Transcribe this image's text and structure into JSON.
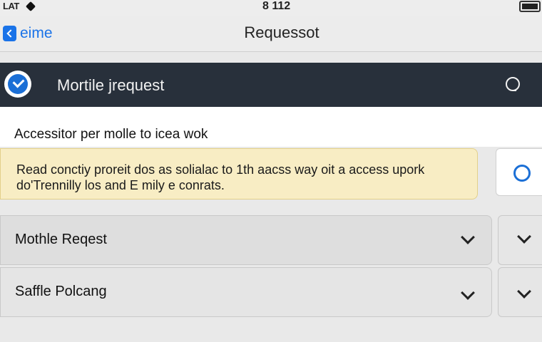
{
  "status_bar": {
    "carrier": "LAT",
    "time": "8 112"
  },
  "nav": {
    "back_label": "eime",
    "title": "Requessot"
  },
  "header": {
    "title": "Mortile jrequest"
  },
  "section": {
    "text": "Accessitor per molle to icea wok"
  },
  "notice": {
    "text": "Read conctiy proreit dos as solialac to 1th aacss way oit a access upork do'Trennilly los and E mily e conrats."
  },
  "rows": [
    {
      "label": "Mothle Reqest"
    },
    {
      "label": "Saffle Polcang"
    }
  ],
  "icons": [
    "signal-icon",
    "battery-icon",
    "back-chevron-icon",
    "check-circle-icon",
    "search-icon",
    "radio-icon",
    "chevron-down-icon"
  ],
  "colors": {
    "accent": "#1b6fd6",
    "header_bg": "#28303b",
    "notice_bg": "#f8edc4"
  }
}
